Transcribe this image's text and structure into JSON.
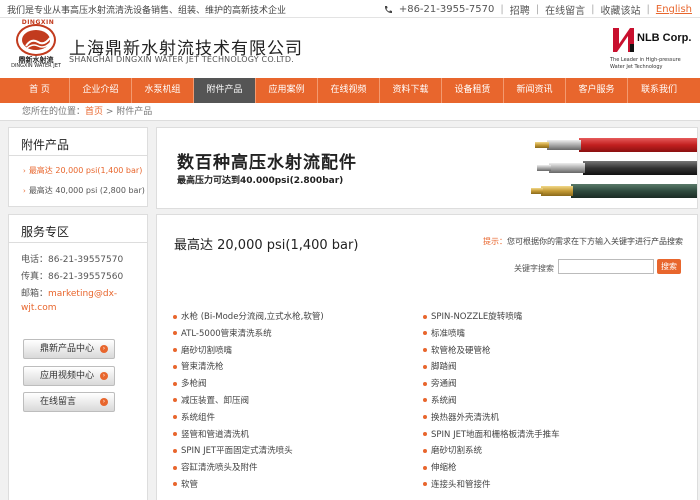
{
  "topbar": {
    "intro": "我们是专业从事高压水射流清洗设备销售、组装、维护的高新技术企业",
    "phone": "+86-21-3955-7570",
    "links": [
      "招聘",
      "在线留言",
      "收藏该站",
      "English"
    ]
  },
  "header": {
    "logo_ring": "DINGXIN",
    "logo_cn": "鼎新水射流",
    "logo_en": "DINGXIN WATER JET",
    "company_cn": "上海鼎新水射流技术有限公司",
    "company_en": "SHANGHAI DINGXIN WATER JET TECHNOLOGY CO.LTD.",
    "nlb_brand": "NLB Corp.",
    "nlb_tag1": "The Leader in High-pressure",
    "nlb_tag2": "Water Jet Technology"
  },
  "nav": [
    {
      "label": "首 页",
      "active": false
    },
    {
      "label": "企业介绍",
      "active": false
    },
    {
      "label": "水泵机组",
      "active": false
    },
    {
      "label": "附件产品",
      "active": true
    },
    {
      "label": "应用案例",
      "active": false
    },
    {
      "label": "在线视频",
      "active": false
    },
    {
      "label": "资料下载",
      "active": false
    },
    {
      "label": "设备租赁",
      "active": false
    },
    {
      "label": "新闻资讯",
      "active": false
    },
    {
      "label": "客户服务",
      "active": false
    },
    {
      "label": "联系我们",
      "active": false
    }
  ],
  "breadcrumb": {
    "prefix": "您所在的位置：",
    "home": "首页",
    "sep": " > ",
    "current": "附件产品"
  },
  "sidebar": {
    "category_title": "附件产品",
    "categories": [
      "最高达 20,000 psi(1,400 bar)",
      "最高达 40,000 psi (2,800 bar)"
    ],
    "service_title": "服务专区",
    "phone_label": "电话：86-21-39557570",
    "fax_label": "传真：86-21-39557560",
    "email_prefix": "邮箱：",
    "email_line1": "marketing@dx-",
    "email_line2": "wjt.com",
    "buttons": [
      "鼎新产品中心",
      "应用视频中心",
      "在线留言"
    ]
  },
  "banner": {
    "headline": "数百种高压水射流配件",
    "subline": "最高压力可达到40.000psi(2.800bar)"
  },
  "content": {
    "title": "最高达 20,000 psi(1,400 bar)",
    "tip_label": "提示：",
    "tip_text": "您可根据你的需求在下方输入关键字进行产品搜索",
    "search_label": "关键字搜索",
    "search_value": "",
    "search_button": "搜索",
    "left_products": [
      "水枪 (Bi-Mode分流阀,立式水枪,软管)",
      "ATL-5000管束清洗系统",
      "磨砂切割喷嘴",
      "管束清洗枪",
      "多枪阀",
      "减压装置、卸压阀",
      "系统组件",
      "竖管和管道清洗机",
      "SPIN JET平面固定式清洗喷头",
      "容缸清洗喷头及附件",
      "软管"
    ],
    "right_products": [
      "SPIN-NOZZLE旋转喷嘴",
      "标准喷嘴",
      "软管枪及硬管枪",
      "脚踏阀",
      "旁通阀",
      "系统阀",
      "换热器外壳清洗机",
      "SPIN JET地面和栅格板清洗手推车",
      "磨砂切割系统",
      "伸缩枪",
      "连接头和管接件"
    ]
  },
  "colors": {
    "accent": "#e8662d",
    "nav_active": "#555555",
    "logo_red": "#c23b1e"
  }
}
